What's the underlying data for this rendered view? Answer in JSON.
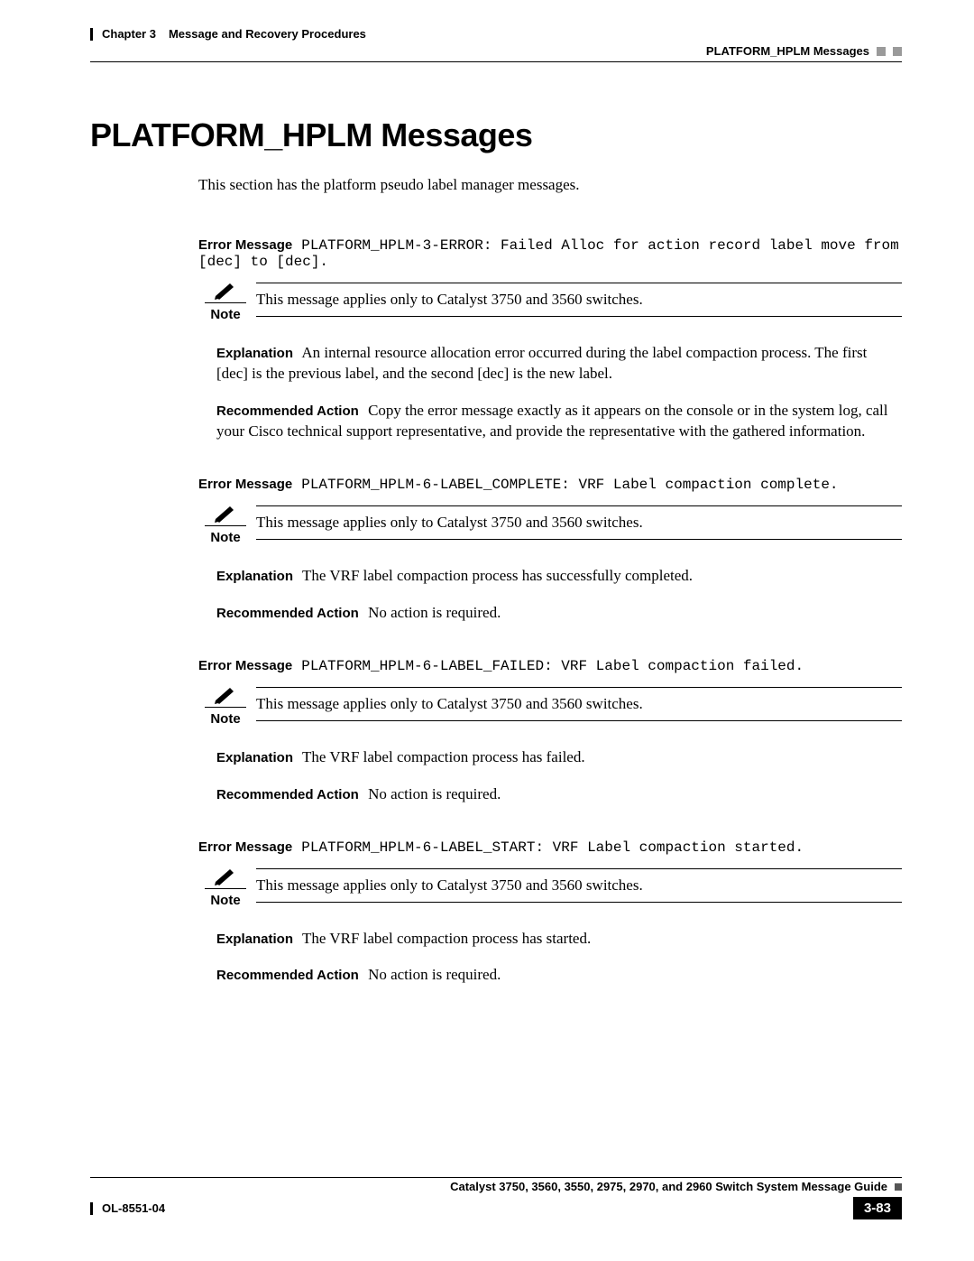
{
  "header": {
    "chapter_no": "Chapter 3",
    "chapter_title": "Message and Recovery Procedures",
    "section_title": "PLATFORM_HPLM Messages"
  },
  "page": {
    "title": "PLATFORM_HPLM Messages",
    "intro": "This section has the platform pseudo label manager messages."
  },
  "labels": {
    "error_message": "Error Message",
    "note": "Note",
    "explanation": "Explanation",
    "recommended_action": "Recommended Action"
  },
  "messages": [
    {
      "code": "PLATFORM_HPLM-3-ERROR: Failed Alloc for action record label move from [dec] to [dec].",
      "note": "This message applies only to Catalyst 3750 and 3560 switches.",
      "explanation": "An internal resource allocation error occurred during the label compaction process. The first [dec] is the previous label, and the second [dec] is the new label.",
      "recommended_action": "Copy the error message exactly as it appears on the console or in the system log, call your Cisco technical support representative, and provide the representative with the gathered information."
    },
    {
      "code": "PLATFORM_HPLM-6-LABEL_COMPLETE: VRF Label compaction complete.",
      "note": "This message applies only to Catalyst 3750 and 3560 switches.",
      "explanation": "The VRF label compaction process has successfully completed.",
      "recommended_action": "No action is required."
    },
    {
      "code": "PLATFORM_HPLM-6-LABEL_FAILED: VRF Label compaction failed.",
      "note": "This message applies only to Catalyst 3750 and 3560 switches.",
      "explanation": "The VRF label compaction process has failed.",
      "recommended_action": "No action is required."
    },
    {
      "code": "PLATFORM_HPLM-6-LABEL_START: VRF Label compaction started.",
      "note": "This message applies only to Catalyst 3750 and 3560 switches.",
      "explanation": "The VRF label compaction process has started.",
      "recommended_action": "No action is required."
    }
  ],
  "footer": {
    "guide_title": "Catalyst 3750, 3560, 3550, 2975, 2970, and 2960 Switch System Message Guide",
    "doc_id": "OL-8551-04",
    "page_number": "3-83"
  }
}
